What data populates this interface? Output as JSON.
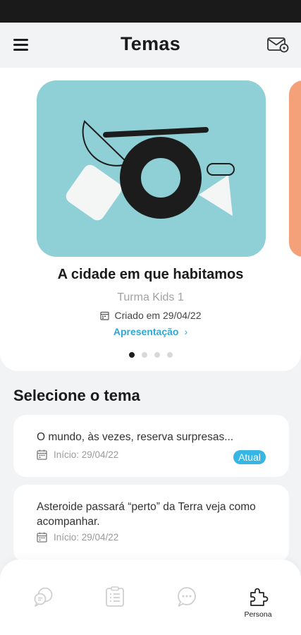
{
  "header": {
    "title": "Temas",
    "menu_icon": "hamburger-menu-icon",
    "mail_icon": "mail-notification-icon"
  },
  "carousel": {
    "current_card": {
      "title": "A cidade em que habitamos",
      "class_name": "Turma Kids 1",
      "created": "Criado em 29/04/22",
      "link_label": "Apresentação",
      "link_chevron": "›",
      "image_bg": "#8fcfd6"
    },
    "next_card_color": "#f4a17a",
    "dots_count": 4,
    "active_dot": 0
  },
  "section": {
    "title": "Selecione o tema"
  },
  "themes": [
    {
      "name": "O mundo, às vezes, reserva surpresas...",
      "date": "Início: 29/04/22",
      "badge": "Atual"
    },
    {
      "name": "Asteroide passará “perto” da Terra veja como acompanhar.",
      "date": "Início: 29/04/22"
    }
  ],
  "bottom_nav": [
    {
      "icon": "chat-bubbles-icon",
      "label": ""
    },
    {
      "icon": "checklist-icon",
      "label": ""
    },
    {
      "icon": "message-dots-icon",
      "label": ""
    },
    {
      "icon": "puzzle-person-icon",
      "label": "Persona",
      "active": true
    }
  ],
  "colors": {
    "accent": "#35b6e3",
    "link": "#2fa8d8",
    "background": "#f2f3f5",
    "status_bar": "#1a1a1a"
  }
}
